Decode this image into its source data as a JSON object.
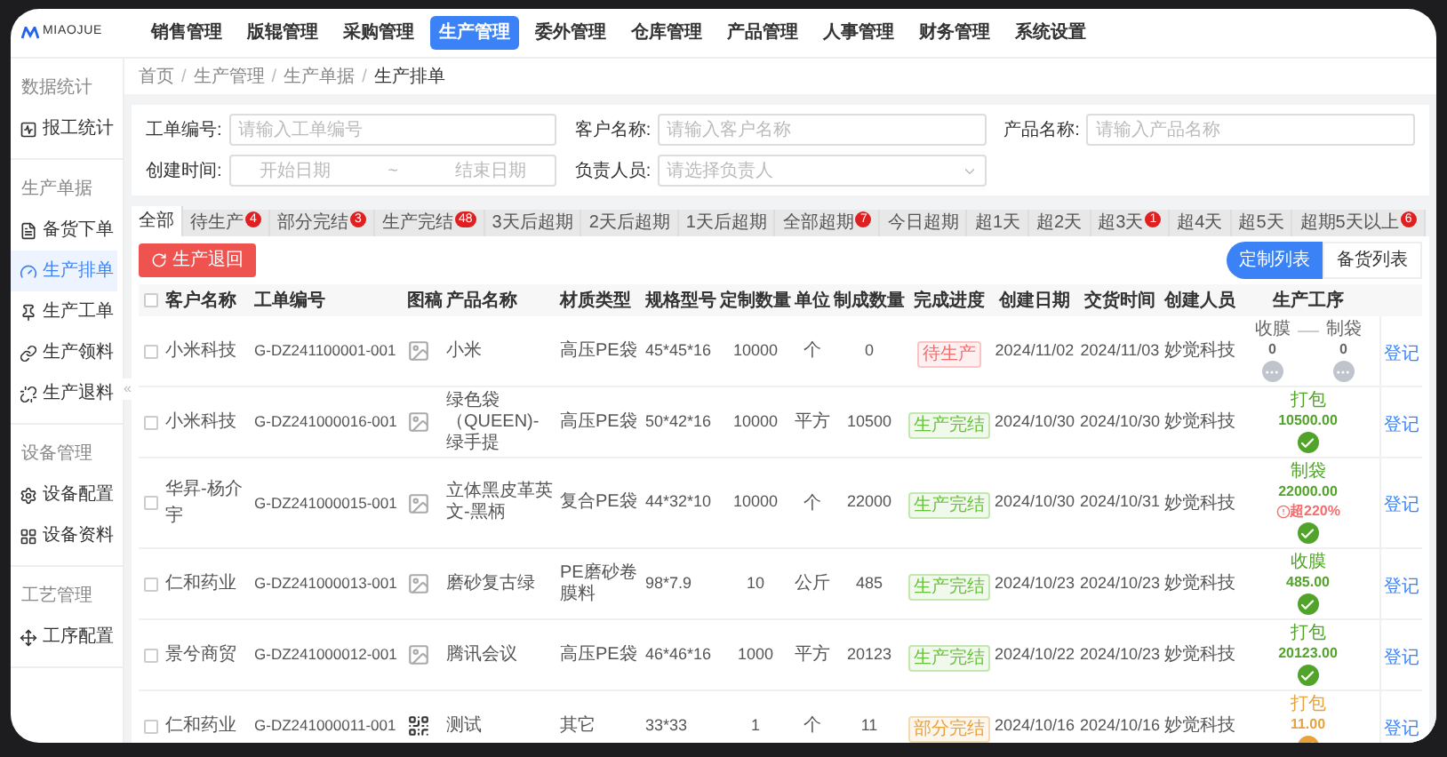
{
  "logo": {
    "text": "MIAOJUE"
  },
  "nav": [
    {
      "label": "销售管理",
      "selected": false
    },
    {
      "label": "版辊管理",
      "selected": false
    },
    {
      "label": "采购管理",
      "selected": false
    },
    {
      "label": "生产管理",
      "selected": true
    },
    {
      "label": "委外管理",
      "selected": false
    },
    {
      "label": "仓库管理",
      "selected": false
    },
    {
      "label": "产品管理",
      "selected": false
    },
    {
      "label": "人事管理",
      "selected": false
    },
    {
      "label": "财务管理",
      "selected": false
    },
    {
      "label": "系统设置",
      "selected": false
    }
  ],
  "sidebar": {
    "collapse": "«",
    "sections": [
      {
        "title": "数据统计",
        "items": [
          {
            "label": "报工统计",
            "selected": false
          }
        ]
      },
      {
        "title": "生产单据",
        "items": [
          {
            "label": "备货下单",
            "selected": false
          },
          {
            "label": "生产排单",
            "selected": true
          },
          {
            "label": "生产工单",
            "selected": false
          },
          {
            "label": "生产领料",
            "selected": false
          },
          {
            "label": "生产退料",
            "selected": false
          }
        ]
      },
      {
        "title": "设备管理",
        "items": [
          {
            "label": "设备配置",
            "selected": false
          },
          {
            "label": "设备资料",
            "selected": false
          }
        ]
      },
      {
        "title": "工艺管理",
        "items": [
          {
            "label": "工序配置",
            "selected": false
          }
        ]
      }
    ]
  },
  "breadcrumb": [
    {
      "label": "首页"
    },
    {
      "separator": "/",
      "label": "生产管理"
    },
    {
      "separator": "/",
      "label": "生产单据"
    },
    {
      "separator": "/",
      "label": "生产排单"
    }
  ],
  "filters": {
    "row_1": [
      {
        "label": "工单编号:",
        "placeholder": "请输入工单编号"
      },
      {
        "label": "客户名称:",
        "placeholder": "请输入客户名称"
      },
      {
        "label": "产品名称:",
        "placeholder": "请输入产品名称"
      }
    ],
    "date": {
      "label": "创建时间:",
      "start_placeholder": "开始日期",
      "separator": "~",
      "end_placeholder": "结束日期"
    },
    "select": {
      "label": "负责人员:",
      "placeholder": "请选择负责人"
    }
  },
  "tabs": [
    {
      "label": "全部",
      "selected": true
    },
    {
      "label": "待生产",
      "badge": "4",
      "selected": false
    },
    {
      "label": "部分完结",
      "badge": "3",
      "selected": false
    },
    {
      "label": "生产完结",
      "badge": "48",
      "selected": false
    },
    {
      "label": "3天后超期",
      "selected": false
    },
    {
      "label": "2天后超期",
      "selected": false
    },
    {
      "label": "1天后超期",
      "selected": false
    },
    {
      "label": "全部超期",
      "badge": "7",
      "selected": false
    },
    {
      "label": "今日超期",
      "selected": false
    },
    {
      "label": "超1天",
      "selected": false
    },
    {
      "label": "超2天",
      "selected": false
    },
    {
      "label": "超3天",
      "badge": "1",
      "selected": false
    },
    {
      "label": "超4天",
      "selected": false
    },
    {
      "label": "超5天",
      "selected": false
    },
    {
      "label": "超期5天以上",
      "badge": "6",
      "selected": false
    }
  ],
  "rollback_button": "生产退回",
  "view_toggle": [
    {
      "label": "定制列表",
      "selected": true
    },
    {
      "label": "备货列表",
      "selected": false
    }
  ],
  "table": {
    "select_all": {
      "checked": false
    },
    "columns": [
      "客户名称",
      "工单编号",
      "图稿",
      "产品名称",
      "材质类型",
      "规格型号",
      "定制数量",
      "单位",
      "制成数量",
      "完成进度",
      "创建日期",
      "交货时间",
      "创建人员",
      "生产工序"
    ],
    "rows": [
      {
        "checked": false,
        "customer": "小米科技",
        "order_no": "G-DZ241100001-001",
        "artwork": {
          "kind": "image"
        },
        "product": "小米",
        "material": "高压PE袋",
        "spec": "45*45*16",
        "qty": "10000",
        "unit": "个",
        "made": "0",
        "progress": {
          "label": "待生产",
          "kind": "pending"
        },
        "created": "2024/11/02",
        "delivery": "2024/11/03",
        "creator": "妙觉科技",
        "steps": [
          {
            "name": "收膜",
            "value": "0",
            "kind": "pending"
          },
          {
            "name": "制袋",
            "value": "0",
            "kind": "pending"
          }
        ],
        "action": "登记"
      },
      {
        "checked": false,
        "customer": "小米科技",
        "order_no": "G-DZ241000016-001",
        "artwork": {
          "kind": "image"
        },
        "product": "绿色袋（QUEEN)-绿手提",
        "material": "高压PE袋",
        "spec": "50*42*16",
        "qty": "10000",
        "unit": "平方",
        "made": "10500",
        "progress": {
          "label": "生产完结",
          "kind": "done"
        },
        "created": "2024/10/30",
        "delivery": "2024/10/30",
        "creator": "妙觉科技",
        "steps": [
          {
            "name": "打包",
            "value": "10500.00",
            "kind": "done"
          }
        ],
        "action": "登记"
      },
      {
        "checked": false,
        "customer": "华昇-杨介宇",
        "order_no": "G-DZ241000015-001",
        "artwork": {
          "kind": "image"
        },
        "product": "立体黑皮革英文-黑柄",
        "material": "复合PE袋",
        "spec": "44*32*10",
        "qty": "10000",
        "unit": "个",
        "made": "22000",
        "progress": {
          "label": "生产完结",
          "kind": "done"
        },
        "created": "2024/10/30",
        "delivery": "2024/10/31",
        "creator": "妙觉科技",
        "steps": [
          {
            "name": "制袋",
            "value": "22000.00",
            "warning": "超220%",
            "kind": "done"
          }
        ],
        "action": "登记"
      },
      {
        "checked": false,
        "customer": "仁和药业",
        "order_no": "G-DZ241000013-001",
        "artwork": {
          "kind": "image"
        },
        "product": "磨砂复古绿",
        "material": "PE磨砂卷膜料",
        "spec": "98*7.9",
        "qty": "10",
        "unit": "公斤",
        "made": "485",
        "progress": {
          "label": "生产完结",
          "kind": "done"
        },
        "created": "2024/10/23",
        "delivery": "2024/10/23",
        "creator": "妙觉科技",
        "steps": [
          {
            "name": "收膜",
            "value": "485.00",
            "kind": "done"
          }
        ],
        "action": "登记"
      },
      {
        "checked": false,
        "customer": "景兮商贸",
        "order_no": "G-DZ241000012-001",
        "artwork": {
          "kind": "image"
        },
        "product": "腾讯会议",
        "material": "高压PE袋",
        "spec": "46*46*16",
        "qty": "1000",
        "unit": "平方",
        "made": "20123",
        "progress": {
          "label": "生产完结",
          "kind": "done"
        },
        "created": "2024/10/22",
        "delivery": "2024/10/23",
        "creator": "妙觉科技",
        "steps": [
          {
            "name": "打包",
            "value": "20123.00",
            "kind": "done"
          }
        ],
        "action": "登记"
      },
      {
        "checked": false,
        "customer": "仁和药业",
        "order_no": "G-DZ241000011-001",
        "artwork": {
          "kind": "qr"
        },
        "product": "测试",
        "material": "其它",
        "spec": "33*33",
        "qty": "1",
        "unit": "个",
        "made": "11",
        "progress": {
          "label": "部分完结",
          "kind": "partial"
        },
        "created": "2024/10/16",
        "delivery": "2024/10/16",
        "creator": "妙觉科技",
        "steps": [
          {
            "name": "打包",
            "value": "11.00",
            "kind": "partial"
          }
        ],
        "action": "登记"
      }
    ]
  }
}
